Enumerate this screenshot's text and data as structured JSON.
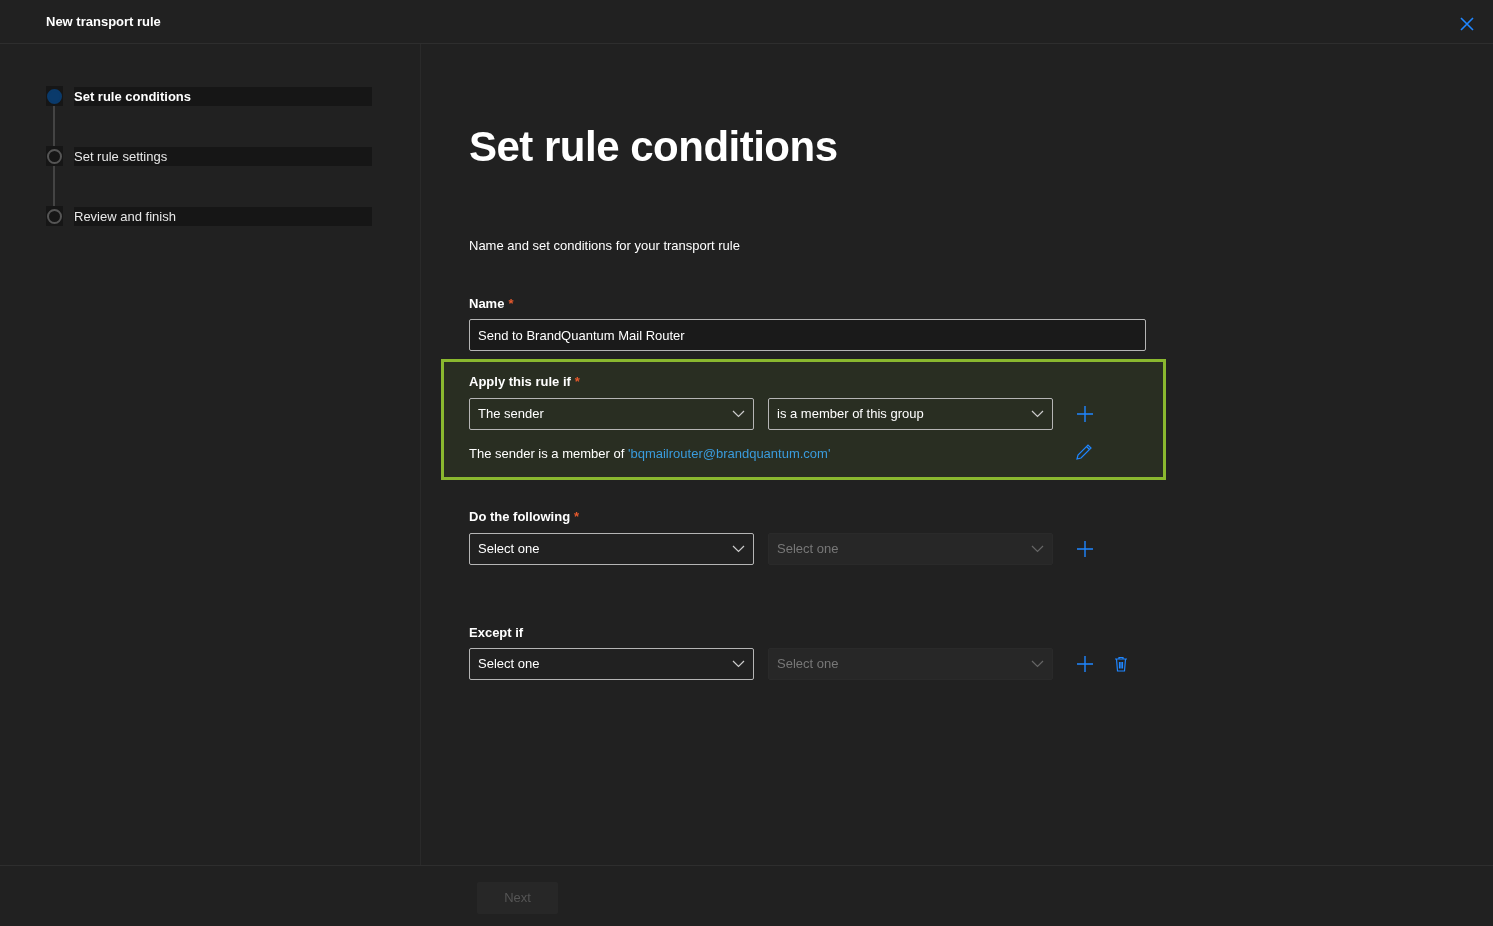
{
  "window": {
    "title": "New transport rule"
  },
  "steps": [
    {
      "label": "Set rule conditions",
      "selected": true
    },
    {
      "label": "Set rule settings",
      "selected": false
    },
    {
      "label": "Review and finish",
      "selected": false
    }
  ],
  "heading": "Set rule conditions",
  "description": "Name and set conditions for your transport rule",
  "name_field": {
    "label": "Name",
    "required_marker": "*",
    "value": "Send to BrandQuantum Mail Router"
  },
  "sections": [
    {
      "label": "Apply this rule if",
      "required_marker": "*",
      "highlighted": true,
      "dropdowns": [
        {
          "value": "The sender",
          "disabled": false
        },
        {
          "value": "is a member of this group",
          "disabled": false
        }
      ],
      "actions": [
        {
          "kind": "add"
        }
      ],
      "summary": "The sender is a member of",
      "summary_link": "'bqmailrouter@brandquantum.com'"
    },
    {
      "label": "Do the following",
      "required_marker": "*",
      "highlighted": false,
      "dropdowns": [
        {
          "value": "Select one",
          "disabled": false
        },
        {
          "value": "Select one",
          "disabled": true
        }
      ],
      "actions": [
        {
          "kind": "add"
        }
      ]
    },
    {
      "label": "Except if",
      "highlighted": false,
      "dropdowns": [
        {
          "value": "Select one",
          "disabled": false
        },
        {
          "value": "Select one",
          "disabled": true
        }
      ],
      "actions": [
        {
          "kind": "add"
        },
        {
          "kind": "delete"
        }
      ]
    }
  ],
  "footer": {
    "next_button": {
      "label": "Next",
      "disabled": true
    }
  }
}
